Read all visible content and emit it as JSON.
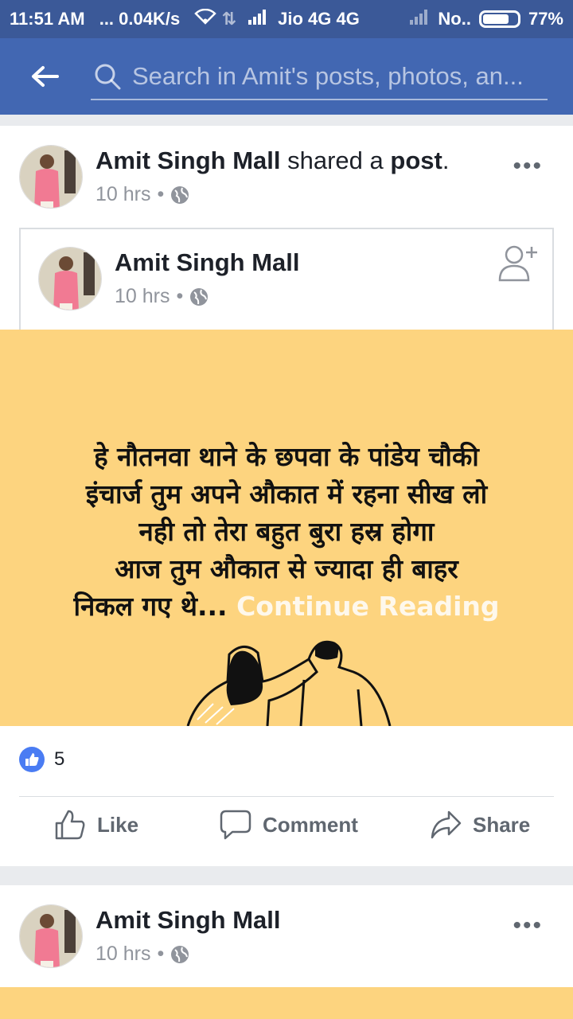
{
  "status_bar": {
    "time": "11:51 AM",
    "speed": "... 0.04K/s",
    "carrier": "Jio 4G 4G",
    "sim2": "No..",
    "battery_percent": "77%",
    "battery_level": 0.77
  },
  "search": {
    "placeholder": "Search in Amit's posts, photos, an..."
  },
  "post1": {
    "author": "Amit Singh Mall",
    "action_text": "shared a",
    "object_text": "post",
    "period": ".",
    "time": "10 hrs",
    "separator": "•",
    "more": "•••",
    "shared": {
      "author": "Amit Singh Mall",
      "time": "10 hrs",
      "separator": "•"
    },
    "quote_lines": [
      "हे नौतनवा थाने के छपवा के पांडेय चौकी",
      "इंचार्ज तुम अपने औकात में रहना सीख लो",
      "नही तो तेरा बहुत बुरा हस्र होगा",
      "आज तुम औकात से ज्यादा ही बाहर",
      "निकल गए थे..."
    ],
    "continue_label": "Continue Reading",
    "likes_count": "5",
    "actions": {
      "like": "Like",
      "comment": "Comment",
      "share": "Share"
    }
  },
  "post2": {
    "author": "Amit Singh Mall",
    "time": "10 hrs",
    "separator": "•",
    "more": "•••"
  },
  "colors": {
    "header_blue": "#4267b2",
    "status_blue": "#3b5998",
    "quote_bg": "#fdd47f",
    "like_blue": "#4a7cf3"
  }
}
